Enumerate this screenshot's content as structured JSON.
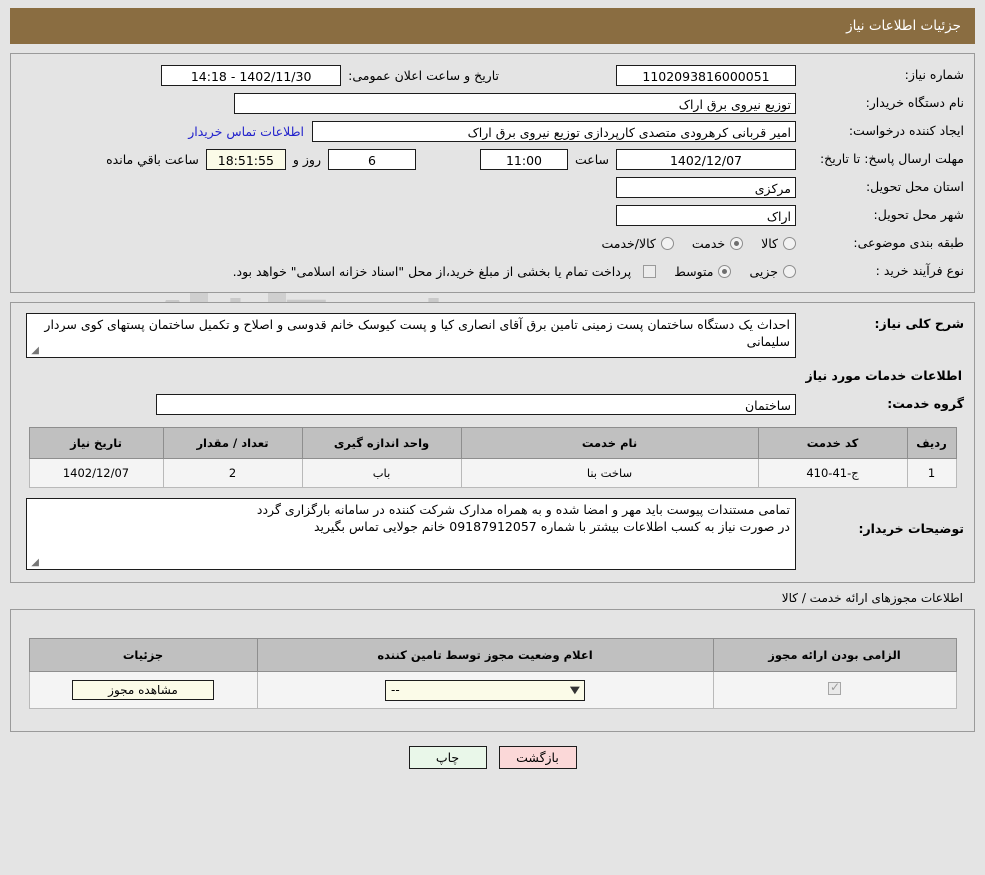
{
  "header": {
    "title": "جزئیات اطلاعات نیاز",
    "bar_color": "#8a6d41"
  },
  "watermark": {
    "brand": "AriaTender",
    "suffix": ".net"
  },
  "form": {
    "need_number_label": "شماره نیاز:",
    "need_number_value": "1102093816000051",
    "announce_label": "تاریخ و ساعت اعلان عمومی:",
    "announce_value": "1402/11/30 - 14:18",
    "buyer_org_label": "نام دستگاه خریدار:",
    "buyer_org_value": "توزیع نیروی برق اراک",
    "creator_label": "ایجاد کننده درخواست:",
    "creator_value": "امیر قربانی کرهرودی متصدی کارپردازی توزیع نیروی برق اراک",
    "contact_link": "اطلاعات تماس خریدار",
    "deadline_label": "مهلت ارسال پاسخ: تا تاریخ:",
    "deadline_date": "1402/12/07",
    "hour_label": "ساعت",
    "deadline_time": "11:00",
    "days_value": "6",
    "days_label": "روز و",
    "remaining_time": "18:51:55",
    "remaining_label": "ساعت باقي مانده",
    "province_label": "استان محل تحویل:",
    "province_value": "مرکزی",
    "city_label": "شهر محل تحویل:",
    "city_value": "اراک",
    "category_label": "طبقه بندی موضوعی:",
    "category_options": [
      {
        "label": "کالا",
        "selected": false
      },
      {
        "label": "خدمت",
        "selected": true
      },
      {
        "label": "کالا/خدمت",
        "selected": false
      }
    ],
    "process_label": "نوع فرآیند خرید :",
    "process_options": [
      {
        "label": "جزیی",
        "selected": false
      },
      {
        "label": "متوسط",
        "selected": true
      }
    ],
    "treasury_note": "پرداخت تمام یا بخشی از مبلغ خرید،از محل \"اسناد خزانه اسلامی\" خواهد بود."
  },
  "description": {
    "label": "شرح کلی نیاز:",
    "value": "احداث یک دستگاه ساختمان پست زمینی تامین برق آقای انصاری کیا و پست کیوسک خانم قدوسی و اصلاح و تکمیل ساختمان پستهای کوی سردار سلیمانی"
  },
  "services": {
    "section_title": "اطلاعات خدمات مورد نیاز",
    "group_label": "گروه خدمت:",
    "group_value": "ساختمان",
    "columns": [
      "ردیف",
      "کد خدمت",
      "نام خدمت",
      "واحد اندازه گیری",
      "تعداد / مقدار",
      "تاریخ نیاز"
    ],
    "rows": [
      {
        "radif": "1",
        "code": "ج-41-410",
        "name": "ساخت بنا",
        "unit": "باب",
        "quantity": "2",
        "need_date": "1402/12/07"
      }
    ]
  },
  "buyer_notes": {
    "label": "توضیحات خریدار:",
    "line1": "تمامی مستندات پیوست باید مهر و امضا شده و به همراه مدارک شرکت کننده در سامانه بارگزاری گردد",
    "line2": "در صورت نیاز به کسب اطلاعات بیشتر با شماره 09187912057 خانم جولایی تماس بگیرید"
  },
  "permits": {
    "section_title": "اطلاعات مجوزهای ارائه خدمت / کالا",
    "columns": [
      "الزامی بودن ارائه مجوز",
      "اعلام وضعیت مجوز توسط تامین کننده",
      "جزئیات"
    ],
    "rows": [
      {
        "required": true,
        "status_value": "--",
        "detail_button": "مشاهده مجوز"
      }
    ]
  },
  "footer": {
    "print_label": "چاپ",
    "back_label": "بازگشت"
  }
}
